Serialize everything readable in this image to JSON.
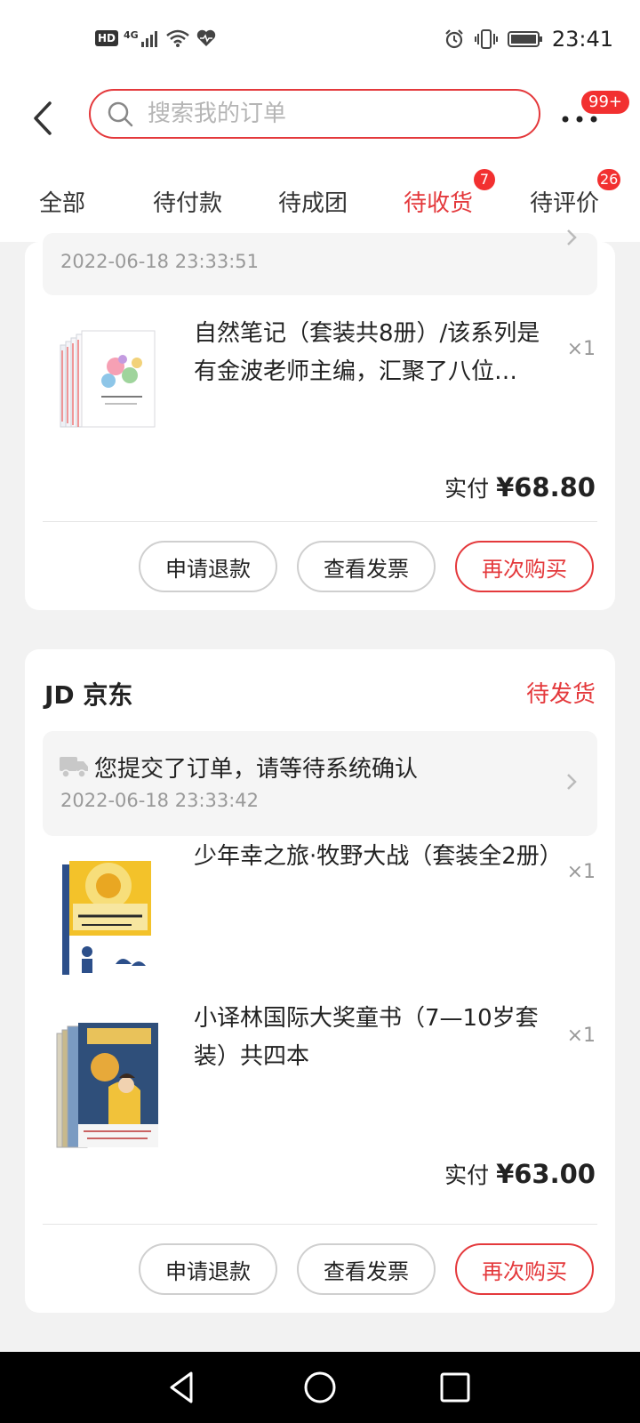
{
  "status_bar": {
    "hd": "HD",
    "network": "4G",
    "time": "23:41"
  },
  "header": {
    "search_placeholder": "搜索我的订单",
    "more_badge": "99+"
  },
  "tabs": [
    {
      "label": "全部",
      "badge": ""
    },
    {
      "label": "待付款",
      "badge": ""
    },
    {
      "label": "待成团",
      "badge": ""
    },
    {
      "label": "待收货",
      "badge": "7",
      "active": true
    },
    {
      "label": "待评价",
      "badge": "26"
    }
  ],
  "orders": [
    {
      "log_time": "2022-06-18 23:33:51",
      "products": [
        {
          "title": "自然笔记（套装共8册）/该系列是有金波老师主编，汇聚了八位…",
          "qty": "×1",
          "image": "book-set-nature-notes"
        }
      ],
      "pay_label": "实付",
      "pay_amount": "¥68.80",
      "buttons": [
        "申请退款",
        "查看发票",
        "再次购买"
      ]
    },
    {
      "shop": "JD 京东",
      "status": "待发货",
      "log_text": "您提交了订单，请等待系统确认",
      "log_time": "2022-06-18 23:33:42",
      "products": [
        {
          "title": "少年幸之旅·牧野大战（套装全2册）",
          "qty": "×1",
          "image": "book-set-muye-battle"
        },
        {
          "title": "小译林国际大奖童书（7—10岁套装）共四本",
          "qty": "×1",
          "image": "book-set-yilin-award"
        }
      ],
      "pay_label": "实付",
      "pay_amount": "¥63.00",
      "buttons": [
        "申请退款",
        "查看发票",
        "再次购买"
      ]
    }
  ],
  "colors": {
    "accent": "#e4393c",
    "badge": "#f23030",
    "background": "#f2f2f2"
  }
}
